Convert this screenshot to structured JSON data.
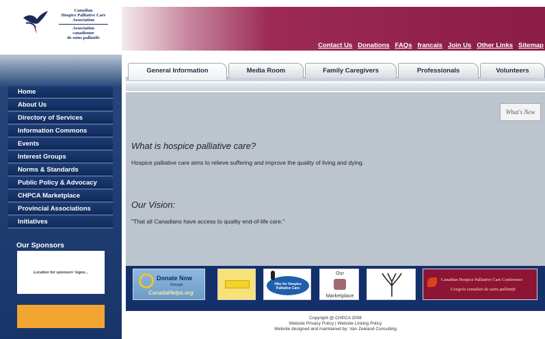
{
  "logo": {
    "line1": "Canadian",
    "line2": "Hospice Palliative Care",
    "line3": "Association",
    "line4": "Association",
    "line5": "canadienne",
    "line6": "de soins palliatifs"
  },
  "topnav": [
    "Contact Us",
    "Donations",
    "FAQs",
    "francais",
    "Join Us",
    "Other Links",
    "Sitemap"
  ],
  "tabs": [
    "General Information",
    "Media Room",
    "Family Caregivers",
    "Professionals",
    "Volunteers"
  ],
  "sidebar": {
    "items": [
      "Home",
      "About Us",
      "Directory of Services",
      "Information Commons",
      "Events",
      "Interest Groups",
      "Norms & Standards",
      "Public Policy & Advocacy",
      "CHPCA Marketplace",
      "Provincial Associations",
      "Initiatives"
    ],
    "sponsors_title": "Our Sponsors",
    "sponsor_placeholder": "Location for sponsors' logos..."
  },
  "main": {
    "whats_new": "What's New",
    "heading1": "What is hospice palliative care?",
    "text1": "Hospice palliative care aims to relieve suffering and improve the quality of living and dying.",
    "heading2": "Our Vision:",
    "text2": "\"That all Canadians have access to quality end-of-life care.\""
  },
  "logos": {
    "donate_title": "Donate Now",
    "donate_through": "through",
    "donate_site": "CanadaHelps.org",
    "hike": "Hike for Hospice Palliative Care",
    "marketplace_our": "Our",
    "marketplace": "Marketplace",
    "conference_en": "Canadian Hospice Palliative Care Conference",
    "conference_fr": "Congrès canadien de soins palliatifs"
  },
  "footer": {
    "line1": "Copyright @ CHPCA 2008",
    "line2": "Website Privacy Policy | Website Linking Policy",
    "line3": "Website designed and maintained by: Van Zeeland Consulting"
  },
  "colors": {
    "header": "#8a1c45",
    "nav": "#183569",
    "main_bg": "#bcc4ce",
    "sponsor_orange": "#f2a531"
  }
}
